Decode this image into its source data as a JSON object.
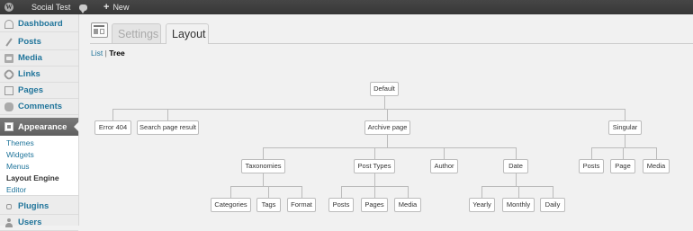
{
  "adminbar": {
    "site_name": "Social Test",
    "new_label": "New",
    "plus": "+"
  },
  "sidebar": {
    "items": [
      {
        "label": "Dashboard",
        "icon": "dashboard-icon"
      },
      {
        "label": "Posts",
        "icon": "posts-icon"
      },
      {
        "label": "Media",
        "icon": "media-icon"
      },
      {
        "label": "Links",
        "icon": "links-icon"
      },
      {
        "label": "Pages",
        "icon": "pages-icon"
      },
      {
        "label": "Comments",
        "icon": "comments-icon"
      },
      {
        "label": "Appearance",
        "icon": "appearance-icon"
      },
      {
        "label": "Plugins",
        "icon": "plugins-icon"
      },
      {
        "label": "Users",
        "icon": "users-icon"
      }
    ],
    "appearance_submenu": [
      "Themes",
      "Widgets",
      "Menus",
      "Layout Engine",
      "Editor"
    ],
    "current_submenu": "Layout Engine"
  },
  "tabs": [
    {
      "label": "Settings",
      "active": false
    },
    {
      "label": "Layout",
      "active": true
    }
  ],
  "views": {
    "list": "List",
    "separator": "|",
    "tree": "Tree",
    "current": "Tree"
  },
  "tree": {
    "root": "Default",
    "level1": [
      "Error 404",
      "Search page result",
      "Archive page",
      "Singular"
    ],
    "archive_children": [
      "Taxonomies",
      "Post Types",
      "Author",
      "Date"
    ],
    "singular_children": [
      "Posts",
      "Page",
      "Media"
    ],
    "taxonomies_children": [
      "Categories",
      "Tags",
      "Format"
    ],
    "post_types_children": [
      "Posts",
      "Pages",
      "Media"
    ],
    "date_children": [
      "Yearly",
      "Monthly",
      "Daily"
    ]
  },
  "colors": {
    "link": "#21759b",
    "adminbar": "#464646",
    "current_menu": "#6d6d6d"
  }
}
